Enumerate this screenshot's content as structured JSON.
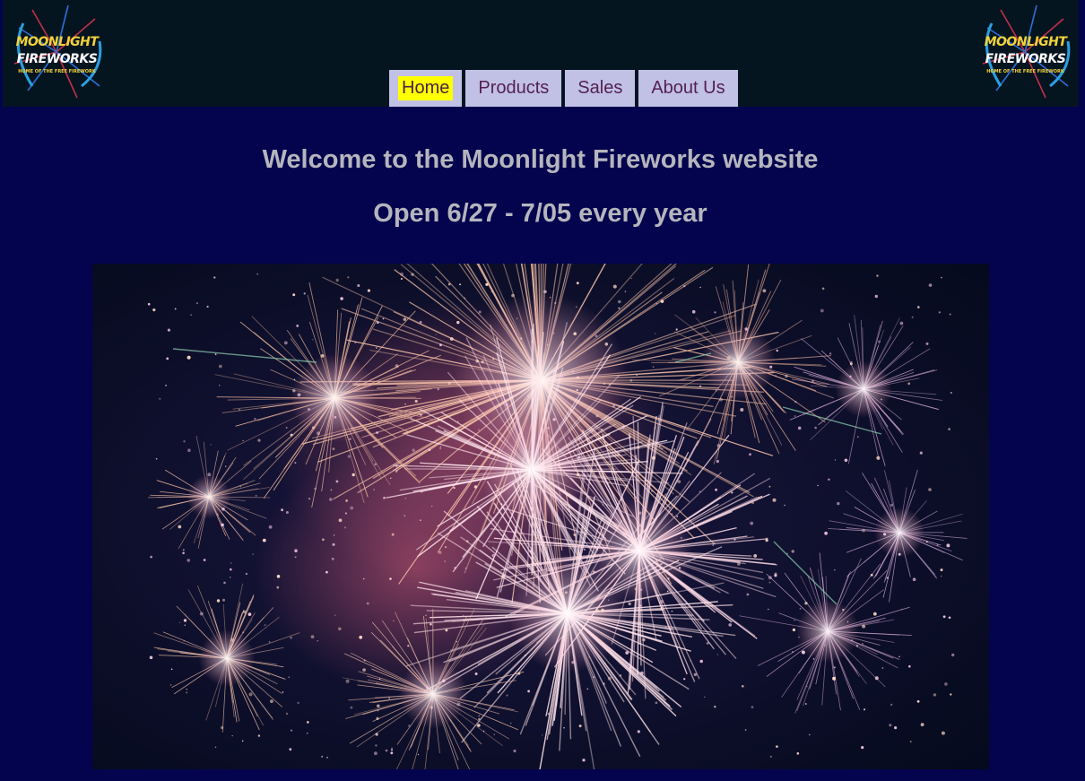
{
  "brand": {
    "name_line1": "MOONLIGHT",
    "name_line2": "FIREWORKS",
    "tagline": "HOME OF THE FREE FIREWORK",
    "colors": {
      "header_bg": "#051520",
      "page_bg": "#03034e",
      "nav_bg": "#c1c1e6",
      "nav_text": "#54214f",
      "active_highlight": "#ffff00",
      "heading_text": "#b5b5bd"
    }
  },
  "nav": {
    "items": [
      {
        "label": "Home",
        "active": true
      },
      {
        "label": "Products",
        "active": false
      },
      {
        "label": "Sales",
        "active": false
      },
      {
        "label": "About Us",
        "active": false
      }
    ]
  },
  "main": {
    "heading": "Welcome to the Moonlight Fireworks website",
    "subheading": "Open 6/27 - 7/05 every year",
    "hero_image": "fireworks-photo"
  }
}
